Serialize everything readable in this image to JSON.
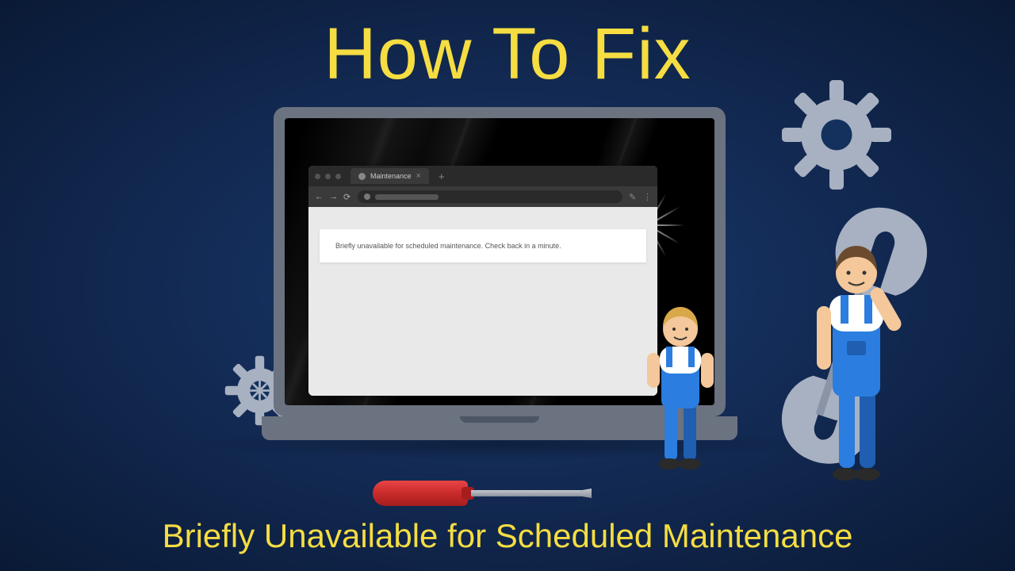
{
  "title": "How To Fix",
  "subtitle": "Briefly Unavailable for Scheduled Maintenance",
  "browser": {
    "tab_label": "Maintenance",
    "page_message": "Briefly unavailable for scheduled maintenance. Check back in a minute."
  },
  "colors": {
    "accent_yellow": "#f5dd42",
    "bg_dark_blue": "#0f2347",
    "gear_grey": "#a7b1c2",
    "worker_blue": "#2b7de0",
    "screwdriver_red": "#c92a2a"
  }
}
